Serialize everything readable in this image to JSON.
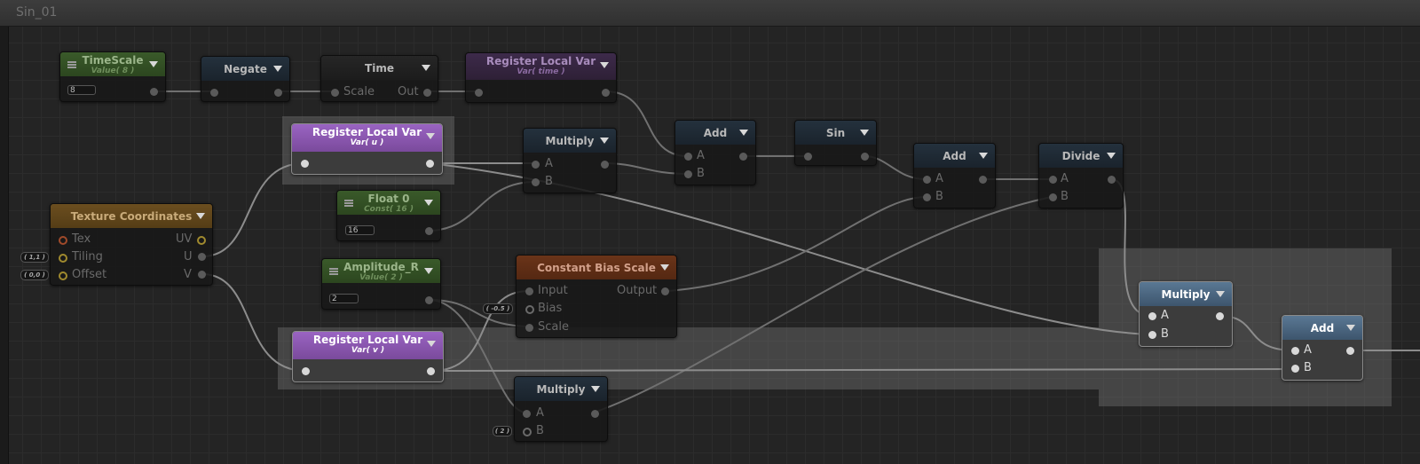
{
  "window": {
    "tab_title": "Sin_01"
  },
  "nodes": {
    "timescale": {
      "title": "TimeScale",
      "subtitle": "Value( 8 )",
      "value": "8"
    },
    "negate": {
      "title": "Negate"
    },
    "time": {
      "title": "Time",
      "in": "Scale",
      "out": "Out"
    },
    "reg_time": {
      "title": "Register Local Var",
      "subtitle": "Var( time )"
    },
    "reg_u": {
      "title": "Register Local Var",
      "subtitle": "Var( u )"
    },
    "multiply1": {
      "title": "Multiply",
      "a": "A",
      "b": "B"
    },
    "add1": {
      "title": "Add",
      "a": "A",
      "b": "B"
    },
    "sin": {
      "title": "Sin"
    },
    "add2": {
      "title": "Add",
      "a": "A",
      "b": "B"
    },
    "divide": {
      "title": "Divide",
      "a": "A",
      "b": "B"
    },
    "float0": {
      "title": "Float 0",
      "subtitle": "Const( 16 )",
      "value": "16"
    },
    "texcoord": {
      "title": "Texture Coordinates",
      "tex": "Tex",
      "tiling": "Tiling",
      "offset": "Offset",
      "uv": "UV",
      "u": "U",
      "v": "V",
      "tiling_default": "( 1,1 )",
      "offset_default": "( 0,0 )"
    },
    "amplitude": {
      "title": "Amplitude_R",
      "subtitle": "Value( 2 )",
      "value": "2"
    },
    "cbs": {
      "title": "Constant Bias Scale",
      "input": "Input",
      "bias": "Bias",
      "scale": "Scale",
      "output": "Output",
      "bias_default": "( -0.5 )"
    },
    "reg_v": {
      "title": "Register Local Var",
      "subtitle": "Var( v )"
    },
    "multiply2": {
      "title": "Multiply",
      "a": "A",
      "b": "B",
      "b_default": "( 2 )"
    },
    "multiply3": {
      "title": "Multiply",
      "a": "A",
      "b": "B"
    },
    "add3": {
      "title": "Add",
      "a": "A",
      "b": "B"
    }
  },
  "colors": {
    "green_header": "#3a5a2a",
    "purple_header": "#9a64c2",
    "blue_header": "#5a7894",
    "orange_header": "#6b4e1f",
    "red_header": "#6a3419",
    "wire": "#8a8a8a"
  }
}
